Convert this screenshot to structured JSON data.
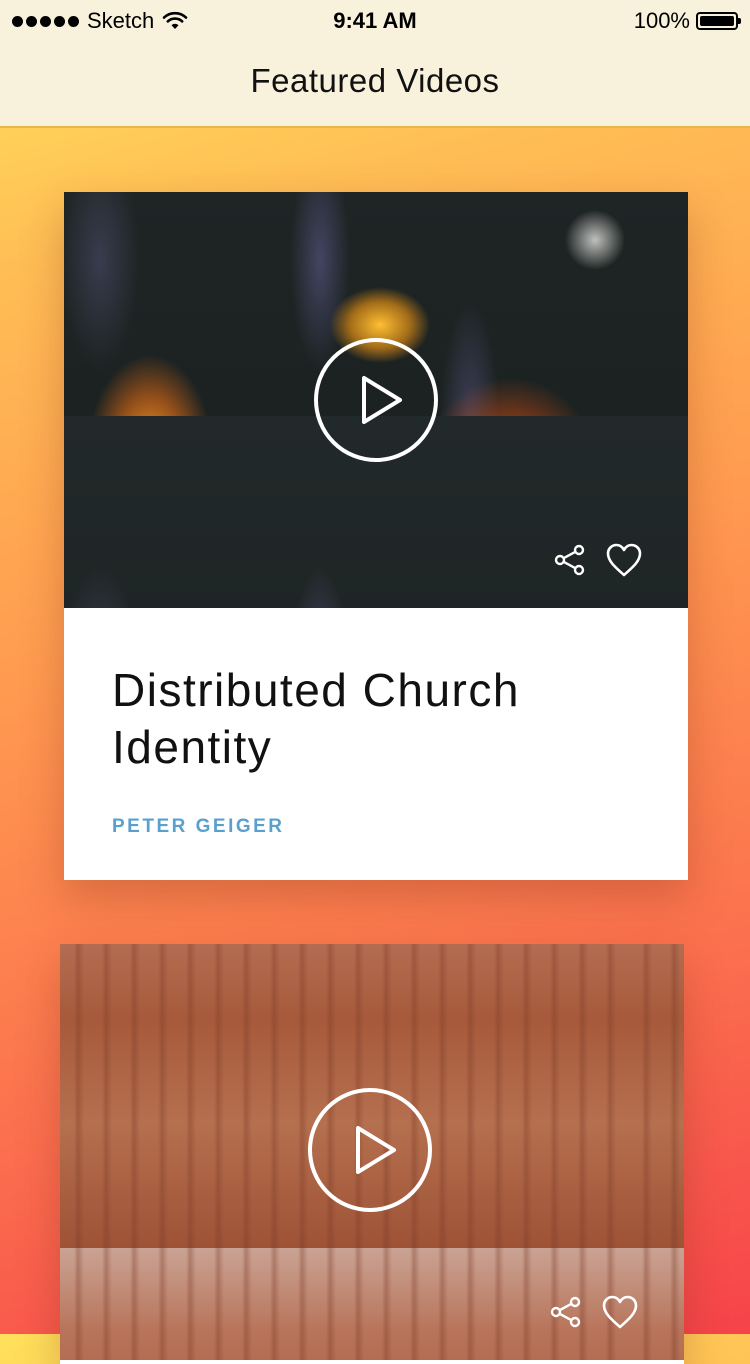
{
  "status_bar": {
    "carrier": "Sketch",
    "time": "9:41 AM",
    "battery": "100%",
    "battery_level": 1.0
  },
  "nav": {
    "title": "Featured Videos"
  },
  "videos": [
    {
      "title": "Distributed Church Identity",
      "author": "PETER GEIGER",
      "thumbnail": "flowers"
    },
    {
      "title": "",
      "author": "",
      "thumbnail": "canyon"
    }
  ],
  "icons": {
    "play": "play-icon",
    "share": "share-icon",
    "like": "heart-icon"
  },
  "colors": {
    "author": "#5aa0cf",
    "nav_background": "#f8f1dc",
    "gradient_top": "#ffe15c",
    "gradient_bottom": "#f6434a"
  }
}
